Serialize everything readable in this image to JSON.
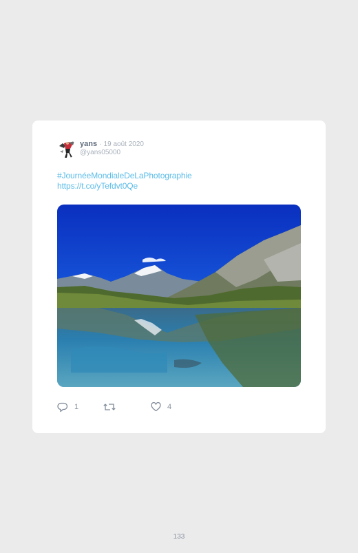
{
  "tweet": {
    "author_name": "yans",
    "separator": "·",
    "date": "19 août 2020",
    "handle": "@yans05000",
    "hashtag": "#JournéeMondialeDeLaPhotographie",
    "link": "https://t.co/yTefdvt0Qe",
    "photo_description": "alpine-lake-reflection-photo",
    "reply_count": "1",
    "like_count": "4"
  },
  "icons": {
    "reply": "reply-icon",
    "retweet": "retweet-icon",
    "like": "heart-icon"
  },
  "colors": {
    "page_background": "#ebebeb",
    "card_background": "#ffffff",
    "link_color": "#5bbce8",
    "muted_text": "#a9b1bc",
    "author_text": "#5e6a7a"
  },
  "footer": {
    "page_number": "133"
  }
}
